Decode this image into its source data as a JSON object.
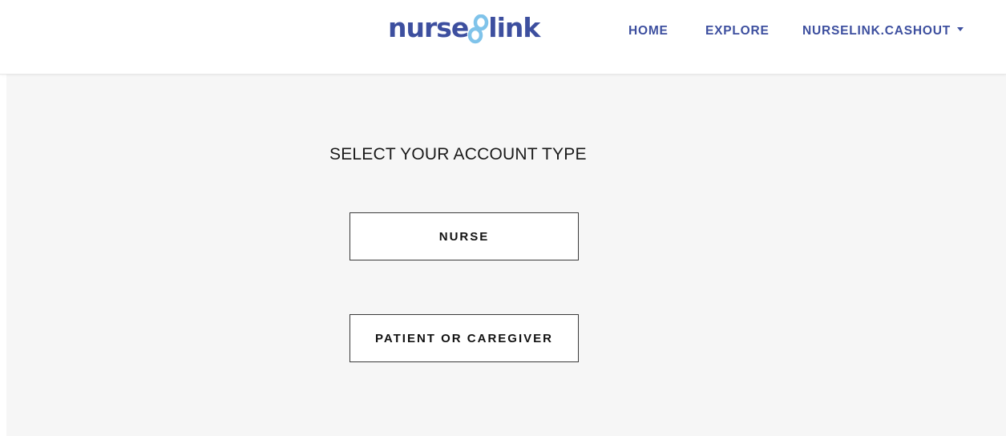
{
  "header": {
    "logo_text_a": "nurse",
    "logo_text_b": "link",
    "nav": {
      "home": "HOME",
      "explore": "EXPLORE",
      "cashout": "NURSELINK.CASHOUT"
    }
  },
  "main": {
    "title": "SELECT YOUR ACCOUNT TYPE",
    "buttons": {
      "nurse": "NURSE",
      "patient": "PATIENT OR CAREGIVER"
    }
  },
  "colors": {
    "brand": "#3d4f9f",
    "logo_accent": "#7fc3ea",
    "background": "#f6f6f6",
    "text": "#111111"
  },
  "icons": {
    "logo_mark": "linked-loops-icon",
    "dropdown": "caret-down-icon"
  }
}
